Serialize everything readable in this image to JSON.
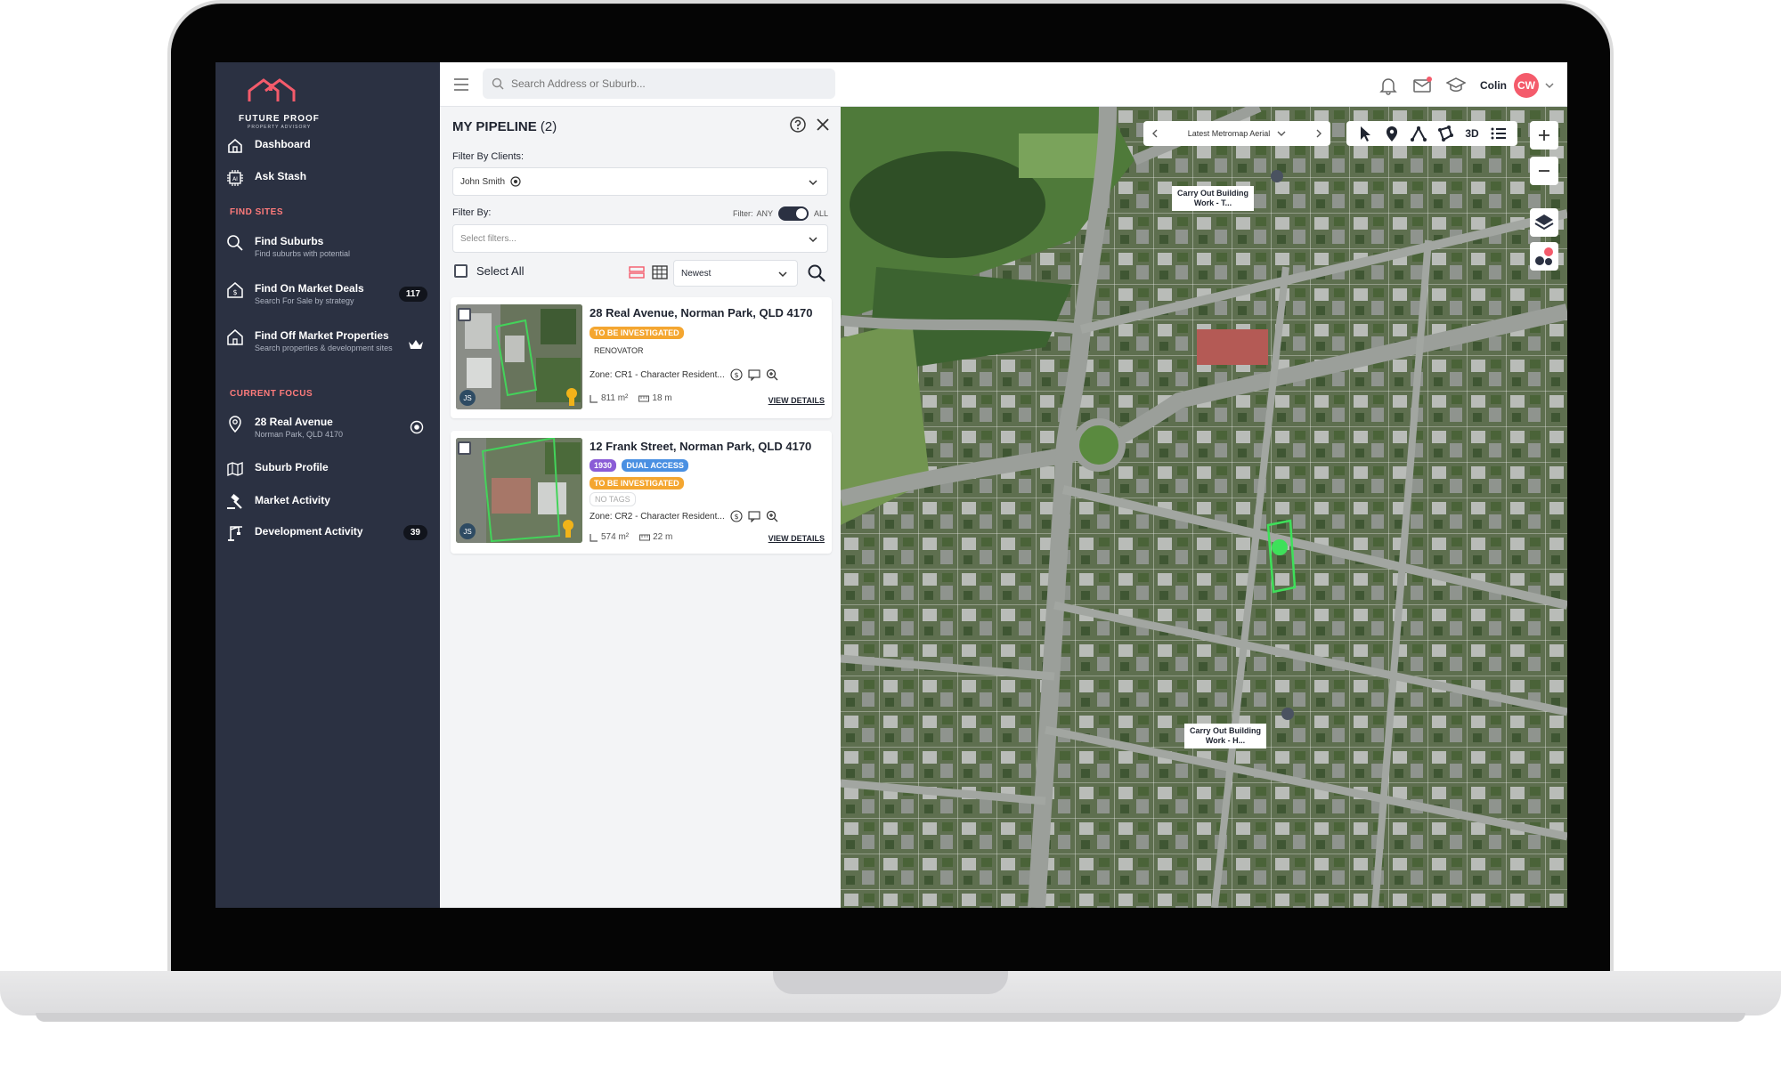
{
  "app": {
    "brand_name": "FUTURE PROOF",
    "brand_sub": "PROPERTY ADVISORY"
  },
  "sidebar": {
    "items": [
      {
        "label": "Dashboard",
        "icon": "home-icon"
      },
      {
        "label": "Ask Stash",
        "icon": "ai-chip-icon"
      }
    ],
    "find_sites_title": "FIND SITES",
    "find_sites": [
      {
        "label": "Find Suburbs",
        "sub": "Find suburbs with potential",
        "icon": "search-icon"
      },
      {
        "label": "Find On Market Deals",
        "sub": "Search For Sale by strategy",
        "icon": "house-dollar-icon",
        "badge": "117"
      },
      {
        "label": "Find Off Market Properties",
        "sub": "Search properties & development sites",
        "icon": "house-outline-icon",
        "badge_icon": "crown-icon"
      }
    ],
    "current_focus_title": "CURRENT FOCUS",
    "focus": {
      "label": "28 Real Avenue",
      "sub": "Norman Park, QLD 4170",
      "icon": "location-pin-icon"
    },
    "focus_items": [
      {
        "label": "Suburb Profile",
        "icon": "map-fold-icon"
      },
      {
        "label": "Market Activity",
        "icon": "gavel-icon"
      },
      {
        "label": "Development Activity",
        "icon": "crane-icon",
        "badge": "39"
      }
    ]
  },
  "topbar": {
    "search_placeholder": "Search Address or Suburb...",
    "user_name": "Colin",
    "user_initials": "CW"
  },
  "pipeline": {
    "title": "MY PIPELINE",
    "count": "(2)",
    "filter_clients_label": "Filter By Clients:",
    "client_value": "John Smith",
    "filter_by_label": "Filter By:",
    "filter_label": "Filter:",
    "filter_any": "ANY",
    "filter_all": "ALL",
    "filters_placeholder": "Select filters...",
    "select_all": "Select All",
    "sort_value": "Newest",
    "cards": [
      {
        "address": "28 Real Avenue, Norman Park, QLD 4170",
        "tag1": "TO BE INVESTIGATED",
        "tag2": "RENOVATOR",
        "zone": "Zone: CR1 - Character Resident...",
        "area": "811 m²",
        "frontage": "18 m",
        "details": "VIEW DETAILS",
        "initials": "JS"
      },
      {
        "address": "12 Frank Street, Norman Park, QLD 4170",
        "tag_year": "1930",
        "tag_dual": "DUAL ACCESS",
        "tag1": "TO BE INVESTIGATED",
        "tag_none": "NO TAGS",
        "zone": "Zone: CR2 - Character Resident...",
        "area": "574 m²",
        "frontage": "22 m",
        "details": "VIEW DETAILS",
        "initials": "JS"
      }
    ]
  },
  "map": {
    "basemap": "Latest Metromap Aerial",
    "tool_3d": "3D",
    "label1_line1": "Carry Out Building",
    "label1_line2": "Work - T...",
    "label2_line1": "Carry Out Building",
    "label2_line2": "Work - H..."
  },
  "colors": {
    "sidebar_bg": "#2b3142",
    "accent": "#f45b6b",
    "tag_orange": "#f4a630",
    "tag_purple": "#8a5cd6",
    "tag_blue": "#4a90e2"
  }
}
